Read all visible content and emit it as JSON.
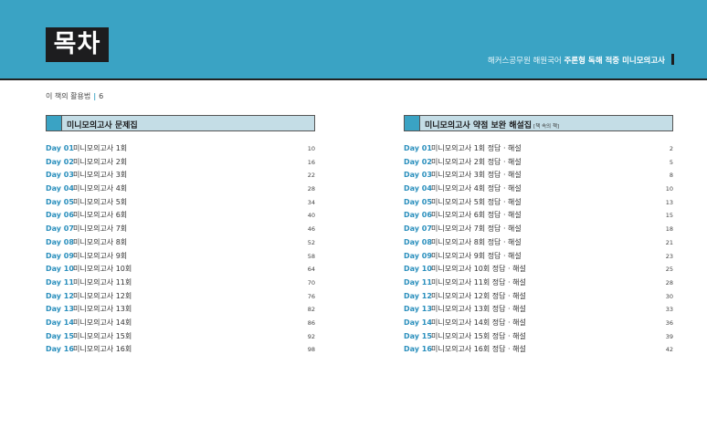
{
  "header": {
    "title": "목차",
    "subtitle_prefix": "해커스공무원 해원국어",
    "subtitle_bold": "주론형 독해 적중 미니모의고사"
  },
  "usage": {
    "label": "이 책의 활용법",
    "page": "6"
  },
  "left_section": {
    "title": "미니모의고사 문제집",
    "items": [
      {
        "day": "Day 01",
        "name": "미니모의고사  1회",
        "page": "10"
      },
      {
        "day": "Day 02",
        "name": "미니모의고사  2회",
        "page": "16"
      },
      {
        "day": "Day 03",
        "name": "미니모의고사  3회",
        "page": "22"
      },
      {
        "day": "Day 04",
        "name": "미니모의고사  4회",
        "page": "28"
      },
      {
        "day": "Day 05",
        "name": "미니모의고사  5회",
        "page": "34"
      },
      {
        "day": "Day 06",
        "name": "미니모의고사  6회",
        "page": "40"
      },
      {
        "day": "Day 07",
        "name": "미니모의고사  7회",
        "page": "46"
      },
      {
        "day": "Day 08",
        "name": "미니모의고사  8회",
        "page": "52"
      },
      {
        "day": "Day 09",
        "name": "미니모의고사  9회",
        "page": "58"
      },
      {
        "day": "Day 10",
        "name": "미니모의고사 10회",
        "page": "64"
      },
      {
        "day": "Day 11",
        "name": "미니모의고사 11회",
        "page": "70"
      },
      {
        "day": "Day 12",
        "name": "미니모의고사 12회",
        "page": "76"
      },
      {
        "day": "Day 13",
        "name": "미니모의고사 13회",
        "page": "82"
      },
      {
        "day": "Day 14",
        "name": "미니모의고사 14회",
        "page": "86"
      },
      {
        "day": "Day 15",
        "name": "미니모의고사 15회",
        "page": "92"
      },
      {
        "day": "Day 16",
        "name": "미니모의고사 16회",
        "page": "98"
      }
    ]
  },
  "right_section": {
    "title": "미니모의고사 약점 보완 해설집",
    "note": "[책 속의 책]",
    "items": [
      {
        "day": "Day 01",
        "name": "미니모의고사  1회 정답 · 해설",
        "page": "2"
      },
      {
        "day": "Day 02",
        "name": "미니모의고사  2회 정답 · 해설",
        "page": "5"
      },
      {
        "day": "Day 03",
        "name": "미니모의고사  3회 정답 · 해설",
        "page": "8"
      },
      {
        "day": "Day 04",
        "name": "미니모의고사  4회 정답 · 해설",
        "page": "10"
      },
      {
        "day": "Day 05",
        "name": "미니모의고사  5회 정답 · 해설",
        "page": "13"
      },
      {
        "day": "Day 06",
        "name": "미니모의고사  6회 정답 · 해설",
        "page": "15"
      },
      {
        "day": "Day 07",
        "name": "미니모의고사  7회 정답 · 해설",
        "page": "18"
      },
      {
        "day": "Day 08",
        "name": "미니모의고사  8회 정답 · 해설",
        "page": "21"
      },
      {
        "day": "Day 09",
        "name": "미니모의고사  9회 정답 · 해설",
        "page": "23"
      },
      {
        "day": "Day 10",
        "name": "미니모의고사 10회 정답 · 해설",
        "page": "25"
      },
      {
        "day": "Day 11",
        "name": "미니모의고사 11회 정답 · 해설",
        "page": "28"
      },
      {
        "day": "Day 12",
        "name": "미니모의고사 12회 정답 · 해설",
        "page": "30"
      },
      {
        "day": "Day 13",
        "name": "미니모의고사 13회 정답 · 해설",
        "page": "33"
      },
      {
        "day": "Day 14",
        "name": "미니모의고사 14회 정답 · 해설",
        "page": "36"
      },
      {
        "day": "Day 15",
        "name": "미니모의고사 15회 정답 · 해설",
        "page": "39"
      },
      {
        "day": "Day 16",
        "name": "미니모의고사 16회 정답 · 해설",
        "page": "42"
      }
    ]
  },
  "colors": {
    "accent": "#3aa3c4",
    "day_label": "#2a8fbd",
    "section_bg": "#c4dde6",
    "dark": "#1d1d1f"
  }
}
